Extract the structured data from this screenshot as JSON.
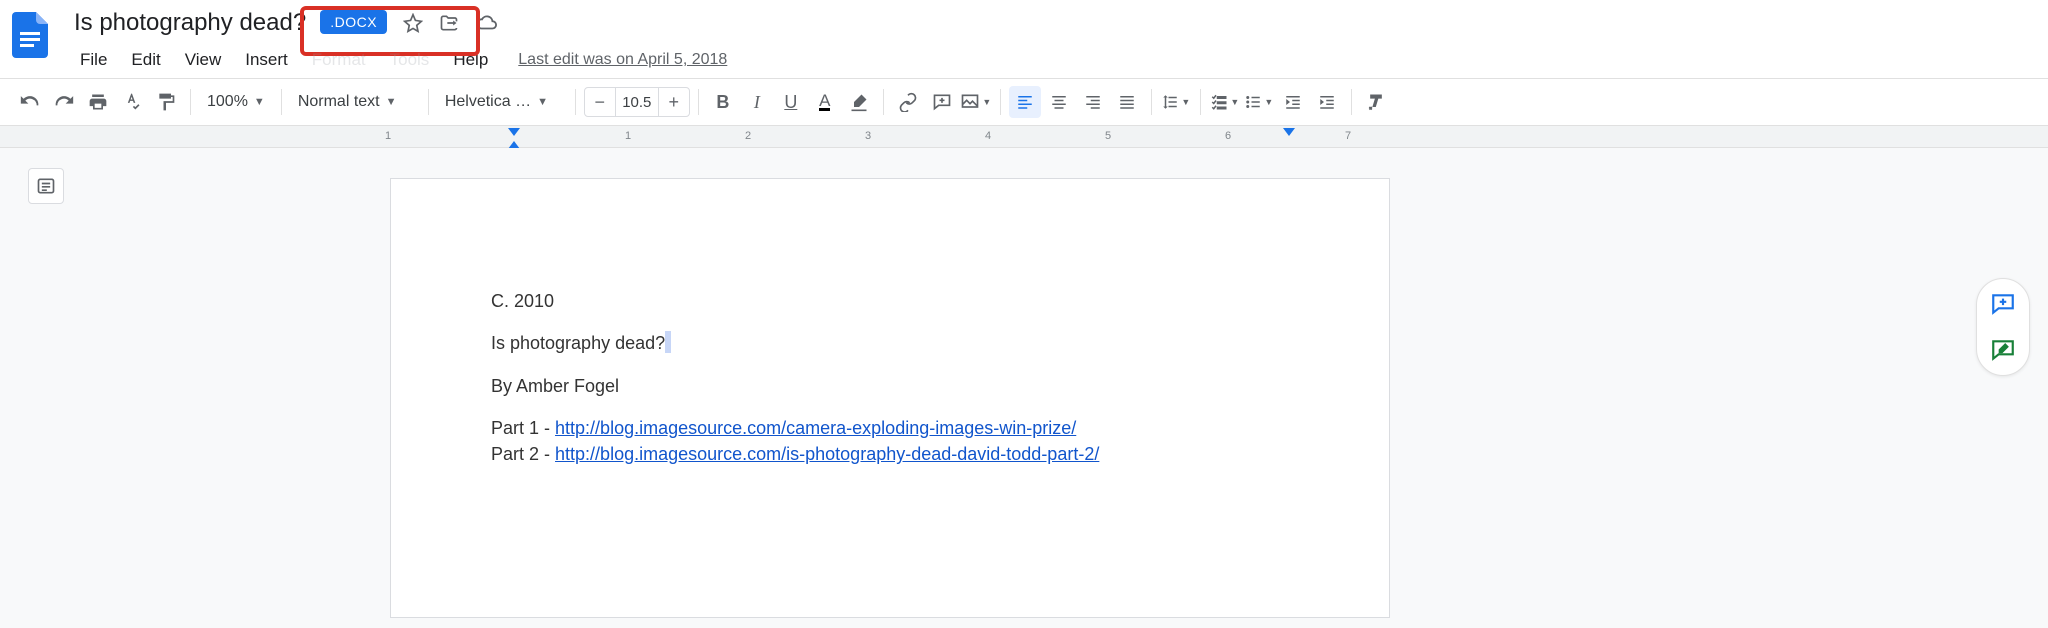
{
  "header": {
    "title": "Is photography dead?",
    "badge": ".DOCX",
    "last_edit": "Last edit was on April 5, 2018"
  },
  "menu": {
    "file": "File",
    "edit": "Edit",
    "view": "View",
    "insert": "Insert",
    "format": "Format",
    "tools": "Tools",
    "help": "Help"
  },
  "toolbar": {
    "zoom": "100%",
    "style": "Normal text",
    "font": "Helvetica …",
    "font_size": "10.5"
  },
  "ruler": {
    "nums": [
      "1",
      "1",
      "2",
      "3",
      "4",
      "5",
      "6",
      "7"
    ]
  },
  "document": {
    "line1": "C. 2010",
    "line2": "Is photography dead?",
    "line3": "By Amber Fogel",
    "part1_label": "Part 1 - ",
    "part1_link": "http://blog.imagesource.com/camera-exploding-images-win-prize/",
    "part2_label": "Part 2 - ",
    "part2_link": "http://blog.imagesource.com/is-photography-dead-david-todd-part-2/"
  }
}
